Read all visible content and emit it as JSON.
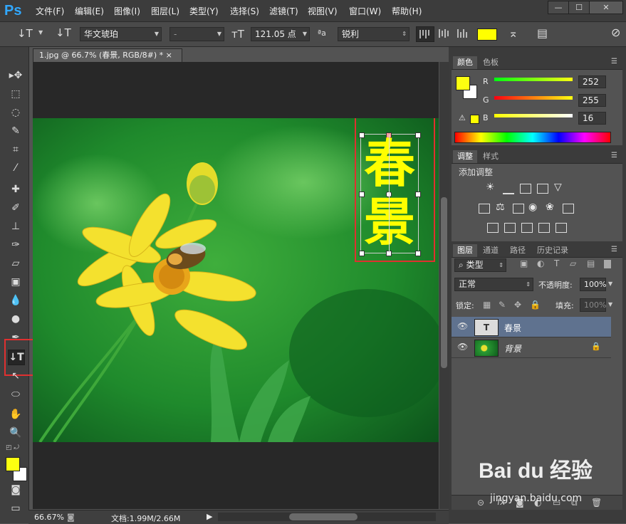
{
  "app": {
    "logo": "Ps"
  },
  "menu": {
    "items": [
      "文件(F)",
      "编辑(E)",
      "图像(I)",
      "图层(L)",
      "类型(Y)",
      "选择(S)",
      "滤镜(T)",
      "视图(V)",
      "窗口(W)",
      "帮助(H)"
    ]
  },
  "window_controls": {
    "minimize": "—",
    "restore": "☐",
    "close": "✕"
  },
  "options": {
    "font_family": "华文琥珀",
    "font_style": "-",
    "font_size": "121.05 点",
    "aa_label": "ªa",
    "aa_mode": "锐利",
    "text_color": "#ffff00"
  },
  "document": {
    "tab_title": "1.jpg @ 66.7% (春景, RGB/8#) *",
    "tab_close": "×",
    "text_layer_text": [
      "春",
      "景"
    ]
  },
  "status": {
    "zoom": "66.67%",
    "doc_info": "文档:1.99M/2.66M"
  },
  "color_panel": {
    "tabs": [
      "颜色",
      "色板"
    ],
    "r_label": "R",
    "r_value": "252",
    "g_label": "G",
    "g_value": "255",
    "b_label": "B",
    "b_value": "16",
    "foreground": "#fcff10"
  },
  "adjust_panel": {
    "tabs": [
      "调整",
      "样式"
    ],
    "title": "添加调整"
  },
  "layers_panel": {
    "tabs": [
      "图层",
      "通道",
      "路径",
      "历史记录"
    ],
    "filter_label": "类型",
    "blend_mode": "正常",
    "opacity_label": "不透明度:",
    "opacity_value": "100%",
    "lock_label": "锁定:",
    "fill_label": "填充:",
    "fill_value": "100%",
    "layers": [
      {
        "name": "春景",
        "thumb": "T"
      },
      {
        "name": "背景"
      }
    ]
  },
  "watermark": {
    "brand": "Bai du 经验",
    "url": "jingyan.baidu.com"
  }
}
